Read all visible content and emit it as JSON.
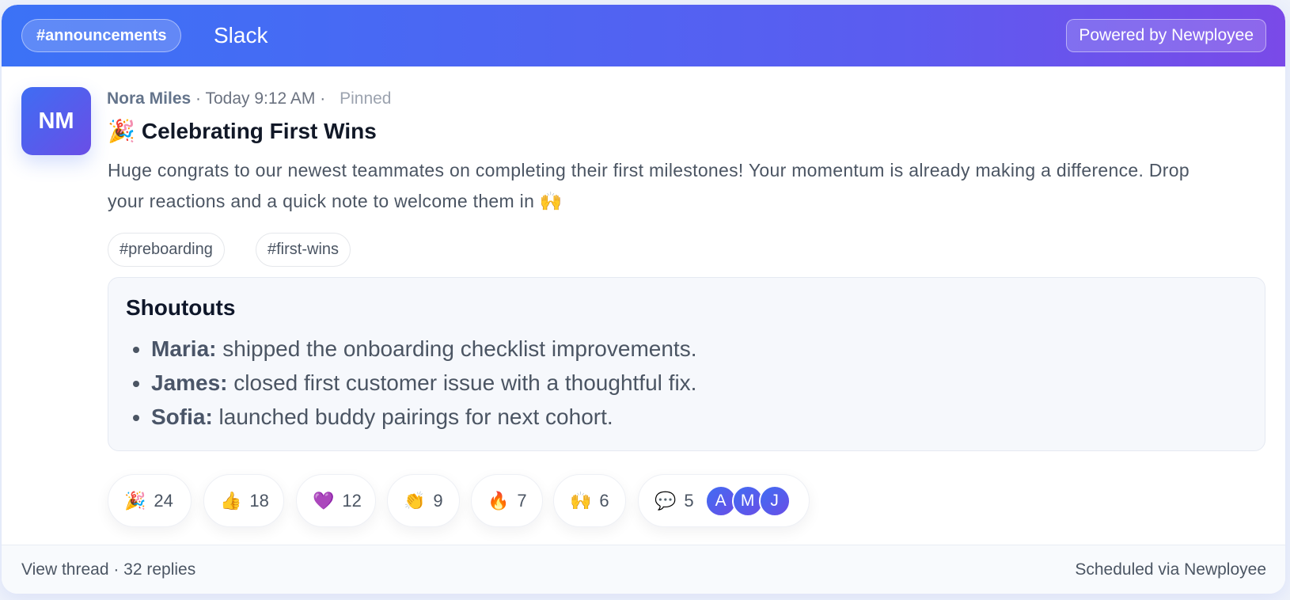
{
  "header": {
    "channel": "#announcements",
    "app_name": "Slack",
    "powered_by": "Powered by Newployee"
  },
  "message": {
    "avatar_initials": "NM",
    "author": "Nora Miles",
    "timestamp": "· Today 9:12 AM ·",
    "pinned_label": "Pinned",
    "title_emoji": "🎉",
    "title": "Celebrating First Wins",
    "body": "Huge congrats to our newest teammates on completing their first milestones! Your momentum is already making a difference. Drop your reactions and a quick note to welcome them in 🙌",
    "tags": [
      "#preboarding",
      "#first-wins"
    ]
  },
  "shoutouts": {
    "title": "Shoutouts",
    "items": [
      {
        "name": "Maria:",
        "text": " shipped the onboarding checklist improvements."
      },
      {
        "name": "James:",
        "text": " closed first customer issue with a thoughtful fix."
      },
      {
        "name": "Sofia:",
        "text": " launched buddy pairings for next cohort."
      }
    ]
  },
  "reactions": [
    {
      "emoji": "🎉",
      "icon": "party-popper-icon",
      "count": "24"
    },
    {
      "emoji": "👍",
      "icon": "thumbs-up-icon",
      "count": "18"
    },
    {
      "emoji": "💜",
      "icon": "purple-heart-icon",
      "count": "12"
    },
    {
      "emoji": "👏",
      "icon": "clapping-hands-icon",
      "count": "9"
    },
    {
      "emoji": "🔥",
      "icon": "fire-icon",
      "count": "7"
    },
    {
      "emoji": "🙌",
      "icon": "raising-hands-icon",
      "count": "6"
    },
    {
      "emoji": "💬",
      "icon": "speech-bubble-icon",
      "count": "5"
    }
  ],
  "reply_avatars": [
    "A",
    "M",
    "J"
  ],
  "footer": {
    "thread_link": "View thread · 32 replies",
    "scheduled": "Scheduled via Newployee"
  },
  "colors": {
    "header_gradient_start": "#3b72f6",
    "header_gradient_end": "#7a4ae8",
    "avatar_gradient_start": "#3f6df3",
    "avatar_gradient_end": "#6a4ee6"
  }
}
